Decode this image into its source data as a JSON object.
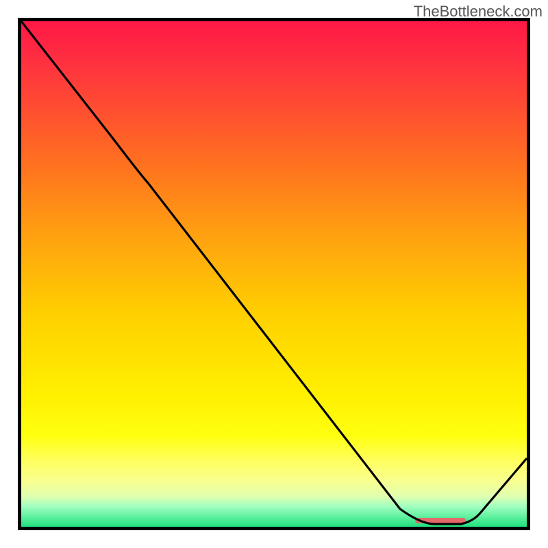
{
  "watermark": "TheBottleneck.com",
  "chart_data": {
    "type": "line",
    "series": [
      {
        "name": "curve",
        "points": [
          {
            "x": 0.0,
            "y": 1.0
          },
          {
            "x": 0.18,
            "y": 0.77
          },
          {
            "x": 0.25,
            "y": 0.68
          },
          {
            "x": 0.75,
            "y": 0.035
          },
          {
            "x": 0.82,
            "y": 0.005
          },
          {
            "x": 0.87,
            "y": 0.005
          },
          {
            "x": 1.0,
            "y": 0.135
          }
        ]
      }
    ],
    "marker": {
      "x0": 0.78,
      "x1": 0.88,
      "y": 0.01,
      "color": "#e36a6a"
    },
    "gradient": [
      "#ff1846",
      "#ffd000",
      "#ffff60",
      "#20e080"
    ]
  }
}
